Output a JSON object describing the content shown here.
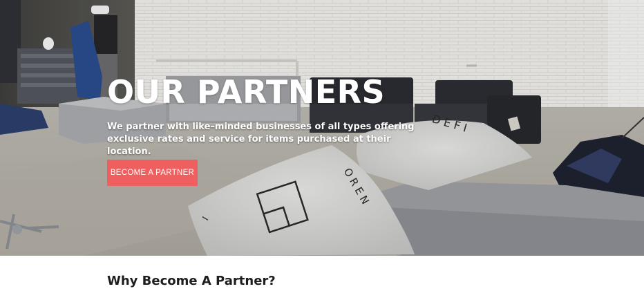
{
  "hero": {
    "title": "OUR PARTNERS",
    "description": "We partner with like–minded businesses of all types offering exclusive rates and service for items purchased at their location.",
    "cta_label": "BECOME A PARTNER",
    "background_image": "warehouse-furniture-pillows",
    "pillow_lettering": [
      "D E F I",
      "O R E N"
    ]
  },
  "why_section": {
    "heading": "Why Become A Partner?"
  },
  "colors": {
    "accent": "#ef5f5f",
    "hero_text": "#ffffff",
    "heading": "#1d1d1d"
  }
}
